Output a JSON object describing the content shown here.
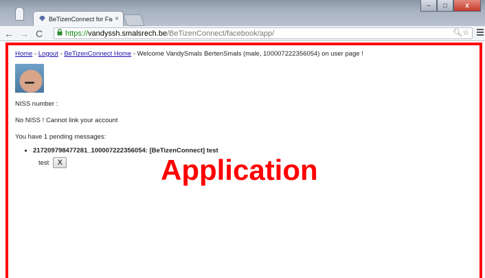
{
  "browser": {
    "tab_title": "BeTizenConnect for Faceb",
    "tab_close": "×",
    "url_scheme": "https://",
    "url_host": "vandyssh.smalsrech.be",
    "url_path": "/BeTizenConnect/facebook/app/",
    "minimize": "–",
    "maximize": "□",
    "close": "x"
  },
  "nav": {
    "home": "Home",
    "sep1": " - ",
    "logout": "Logout",
    "sep2": " - ",
    "betizen_home": "BeTizenConnect Home",
    "welcome": " - Welcome VandySmals BertenSmals (male, 100007222356054) on user page !"
  },
  "page": {
    "niss_label": "NISS number :",
    "no_niss": "No NISS ! Cannot link your account",
    "pending": "You have 1 pending messages:",
    "message_title": "217209798477281_100007222356054: [BeTizenConnect] test",
    "message_body": "test",
    "delete_label": "X"
  },
  "annotation": {
    "label": "Application",
    "color": "#ff0000"
  }
}
